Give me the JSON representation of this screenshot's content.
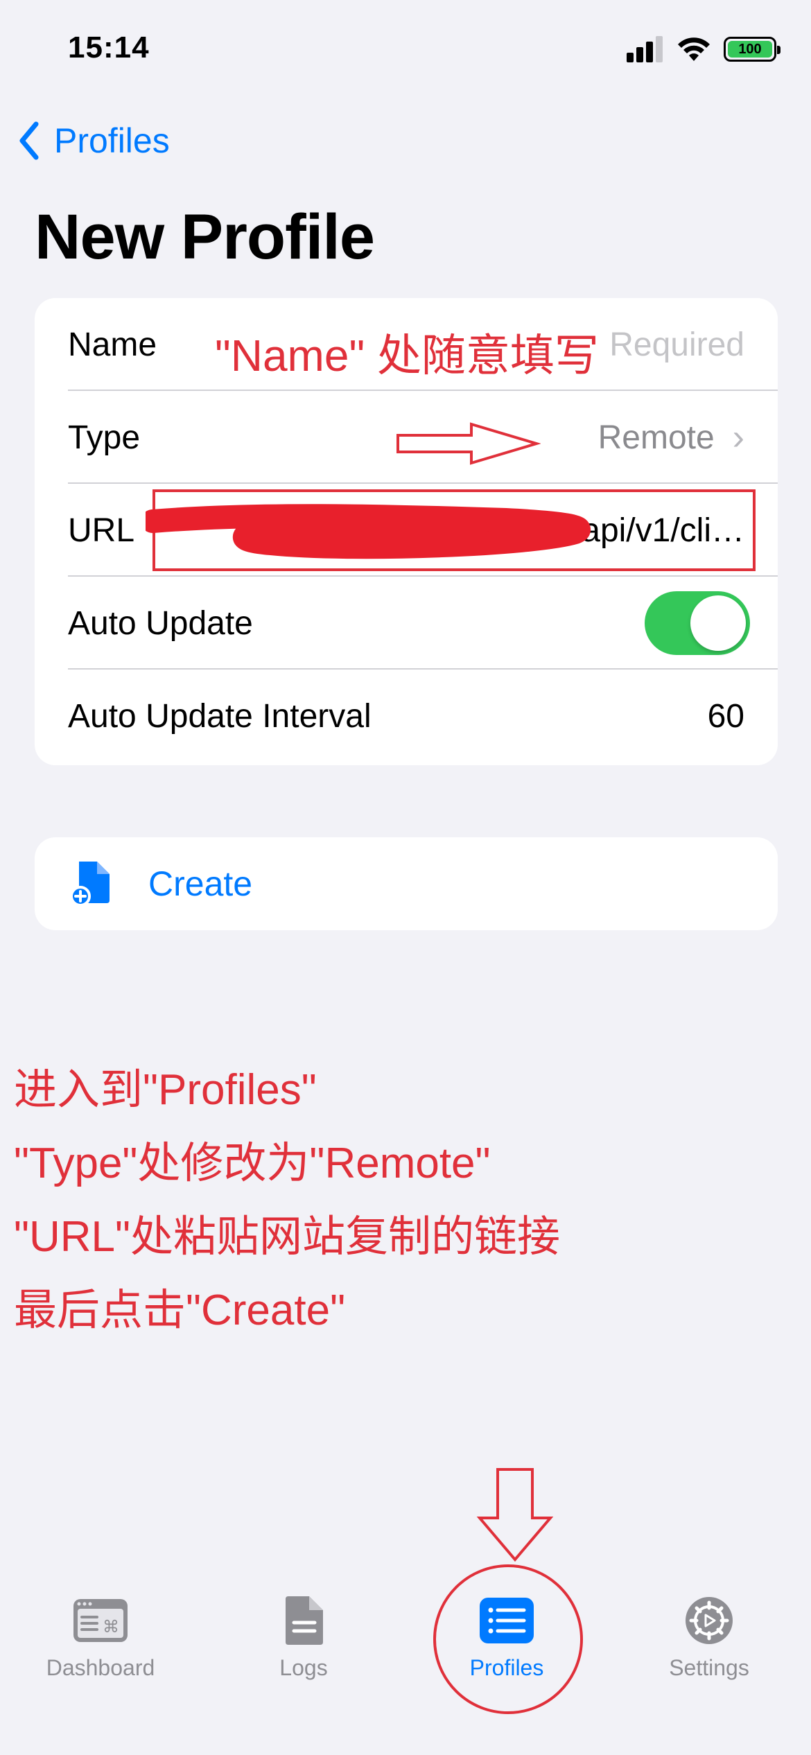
{
  "status_bar": {
    "time": "15:14",
    "battery_level": "100"
  },
  "nav": {
    "back_label": "Profiles",
    "title": "New Profile"
  },
  "form": {
    "name_label": "Name",
    "name_placeholder": "Required",
    "type_label": "Type",
    "type_value": "Remote",
    "url_label": "URL",
    "url_value": "https://…xyz/api/v1/cli…",
    "auto_update_label": "Auto Update",
    "auto_update_on": true,
    "interval_label": "Auto Update Interval",
    "interval_value": "60"
  },
  "create_button": {
    "label": "Create"
  },
  "annotations": {
    "name_hint": "\"Name\" 处随意填写",
    "steps": [
      "进入到\"Profiles\"",
      "\"Type\"处修改为\"Remote\"",
      "\"URL\"处粘贴网站复制的链接",
      "最后点击\"Create\""
    ],
    "color": "#e0303a"
  },
  "tab_bar": {
    "items": [
      {
        "label": "Dashboard",
        "icon": "dashboard-icon"
      },
      {
        "label": "Logs",
        "icon": "doc-icon"
      },
      {
        "label": "Profiles",
        "icon": "list-icon"
      },
      {
        "label": "Settings",
        "icon": "gear-icon"
      }
    ],
    "active": "Profiles"
  },
  "colors": {
    "accent": "#007aff",
    "toggle_on": "#34c759",
    "background": "#f2f2f7"
  }
}
